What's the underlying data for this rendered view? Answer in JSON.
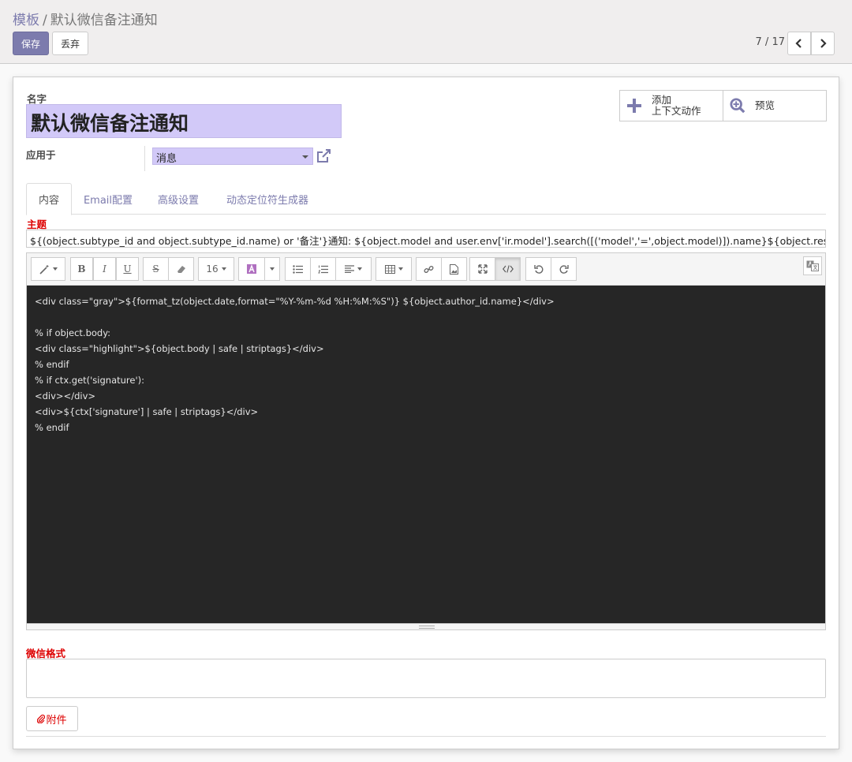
{
  "breadcrumb": {
    "parent": "模板",
    "separator": "/",
    "current": "默认微信备注通知"
  },
  "buttons": {
    "save": "保存",
    "discard": "丢弃"
  },
  "pager": {
    "value": "7 / 17"
  },
  "form": {
    "name_label": "名字",
    "name_value": "默认微信备注通知",
    "applies_label": "应用于",
    "applies_value": "消息",
    "subject_label": "主题",
    "subject_value": "${(object.subtype_id and object.subtype_id.name) or '备注'}通知: ${object.model and user.env['ir.model'].search([('model','=',object.model)]).name}${object.res_id}(${object.subject or ''})",
    "wechat_label": "微信格式",
    "wechat_value": "",
    "attach_label": "附件"
  },
  "smart_buttons": {
    "add_line1": "添加",
    "add_line2": "上下文动作",
    "preview": "预览"
  },
  "tabs": [
    "内容",
    "Email配置",
    "高级设置",
    "动态定位符生成器"
  ],
  "editor": {
    "font_size": "16",
    "code_lines": [
      "<div class=\"gray\">${format_tz(object.date,format=\"%Y-%m-%d %H:%M:%S\")} ${object.author_id.name}</div>",
      "",
      "% if object.body:",
      "<div class=\"highlight\">${object.body | safe | striptags}</div>",
      "% endif",
      "% if ctx.get('signature'):",
      "<div></div>",
      "<div>${ctx['signature'] | safe | striptags}</div>",
      "% endif"
    ]
  },
  "colors": {
    "primary": "#7c7bad",
    "required_field_bg": "#d2c9f8",
    "code_bg": "#262626",
    "required_label": "#d00000"
  }
}
